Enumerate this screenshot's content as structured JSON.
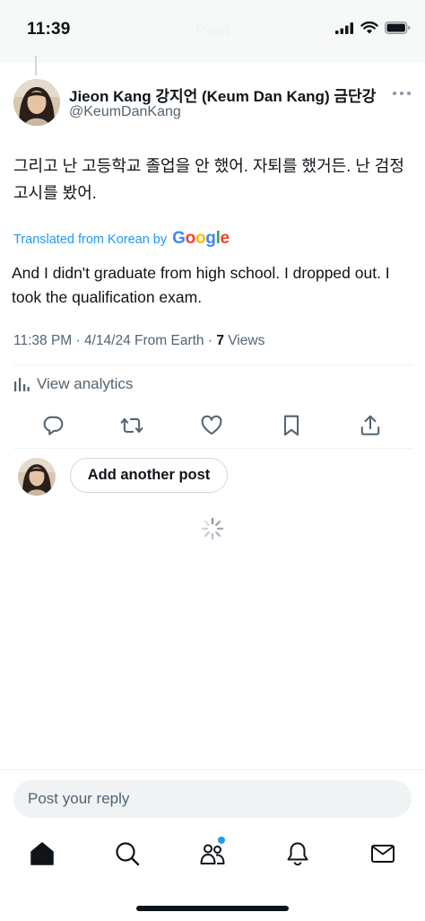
{
  "status_bar": {
    "time": "11:39",
    "faded_title": "Post"
  },
  "post": {
    "author": {
      "display_name": "Jieon Kang 강지언 (Keum Dan Kang) 금단강",
      "handle": "@KeumDanKang"
    },
    "text_original": "그리고 난 고등학교 졸업을 안 했어. 자퇴를 했거든. 난 검정고시를 봤어.",
    "translation_label": "Translated from Korean by",
    "translation_provider": "Google",
    "text_translated": "And I didn't graduate from high school. I dropped out. I took the qualification exam.",
    "meta": {
      "time": "11:38 PM",
      "date": "4/14/24",
      "source": "From Earth",
      "views_count": "7",
      "views_label": "Views"
    },
    "analytics_label": "View analytics"
  },
  "actions": [
    "reply-icon",
    "repost-icon",
    "like-icon",
    "bookmark-icon",
    "share-icon"
  ],
  "compose": {
    "add_post_label": "Add another post"
  },
  "reply_bar": {
    "placeholder": "Post your reply"
  },
  "bottom_nav": [
    "home-icon",
    "search-icon",
    "communities-icon",
    "notifications-icon",
    "messages-icon"
  ],
  "colors": {
    "accent": "#1d9bf0",
    "text_primary": "#0f1419",
    "text_secondary": "#536471",
    "divider": "#eff3f4"
  }
}
